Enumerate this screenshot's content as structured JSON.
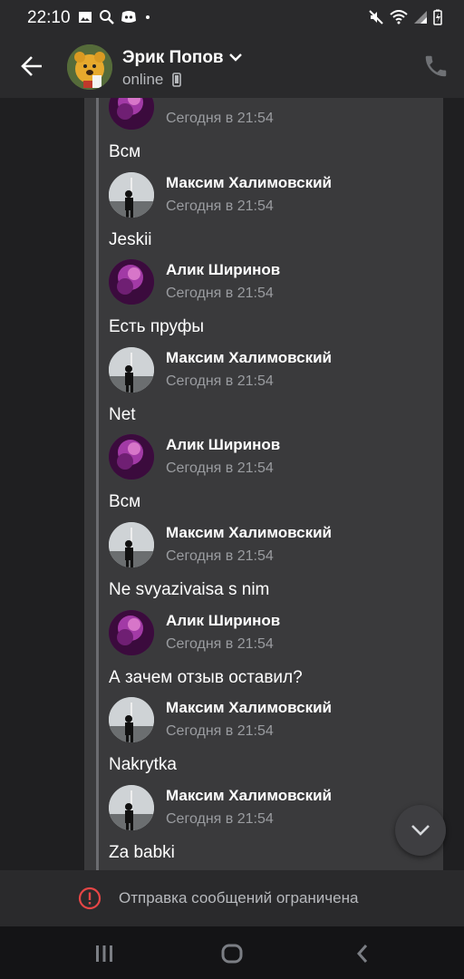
{
  "status_bar": {
    "time": "22:10"
  },
  "header": {
    "contact_name": "Эрик Попов",
    "contact_status": "online"
  },
  "messages": [
    {
      "author": "",
      "time": "Сегодня в 21:54",
      "text": "Всм",
      "avatar": "purple"
    },
    {
      "author": "Максим Халимовский",
      "time": "Сегодня в 21:54",
      "text": "Jeskii",
      "avatar": "photo"
    },
    {
      "author": "Алик Ширинов",
      "time": "Сегодня в 21:54",
      "text": "Есть пруфы",
      "avatar": "purple"
    },
    {
      "author": "Максим Халимовский",
      "time": "Сегодня в 21:54",
      "text": "Net",
      "avatar": "photo"
    },
    {
      "author": "Алик Ширинов",
      "time": "Сегодня в 21:54",
      "text": "Всм",
      "avatar": "purple"
    },
    {
      "author": "Максим Халимовский",
      "time": "Сегодня в 21:54",
      "text": "Ne svyazivaisa s nim",
      "avatar": "photo"
    },
    {
      "author": "Алик Ширинов",
      "time": "Сегодня в 21:54",
      "text": "А зачем отзыв оставил?",
      "avatar": "purple"
    },
    {
      "author": "Максим Халимовский",
      "time": "Сегодня в 21:54",
      "text": "Nakrytka",
      "avatar": "photo"
    },
    {
      "author": "Максим Халимовский",
      "time": "Сегодня в 21:54",
      "text": "Za babki",
      "avatar": "photo"
    }
  ],
  "restriction": {
    "text": "Отправка сообщений ограничена"
  },
  "colors": {
    "background": "#19191a",
    "bar": "#2a2a2c",
    "bubble": "#3a3a3c",
    "alert": "#e64646"
  }
}
